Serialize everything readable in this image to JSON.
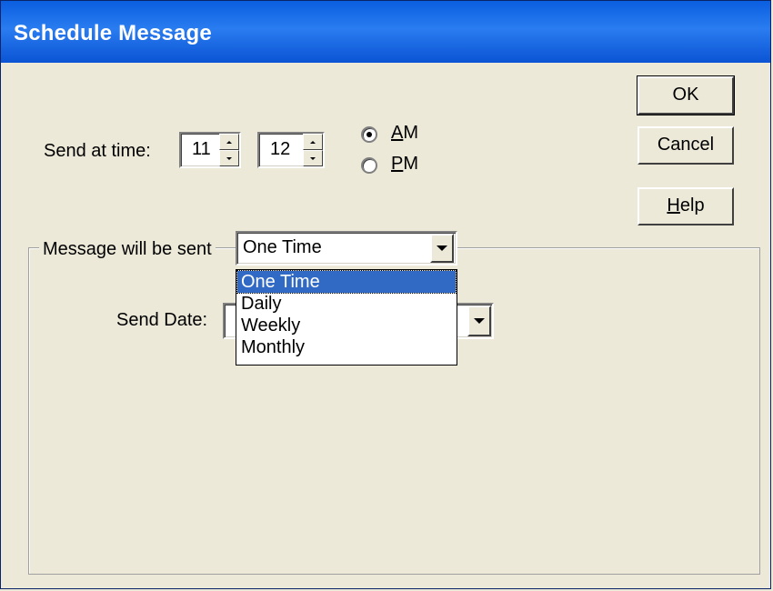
{
  "window": {
    "title": "Schedule Message"
  },
  "send_time": {
    "label": "Send at time:",
    "hour": "11",
    "minute": "12",
    "am_prefix": "",
    "am_mnemonic": "A",
    "am_rest": "M",
    "pm_mnemonic": "P",
    "pm_rest": "M",
    "selected_period": "AM"
  },
  "buttons": {
    "ok": "OK",
    "cancel": "Cancel",
    "help_mnemonic": "H",
    "help_rest": "elp"
  },
  "frequency": {
    "label": "Message will be sent",
    "selected": "One Time",
    "options": [
      "One Time",
      "Daily",
      "Weekly",
      "Monthly"
    ]
  },
  "send_date": {
    "label": "Send Date:",
    "value": ""
  },
  "colors": {
    "titlebar": "#0a5fe0",
    "dialog_bg": "#ece9d8",
    "selection": "#316ac5"
  }
}
